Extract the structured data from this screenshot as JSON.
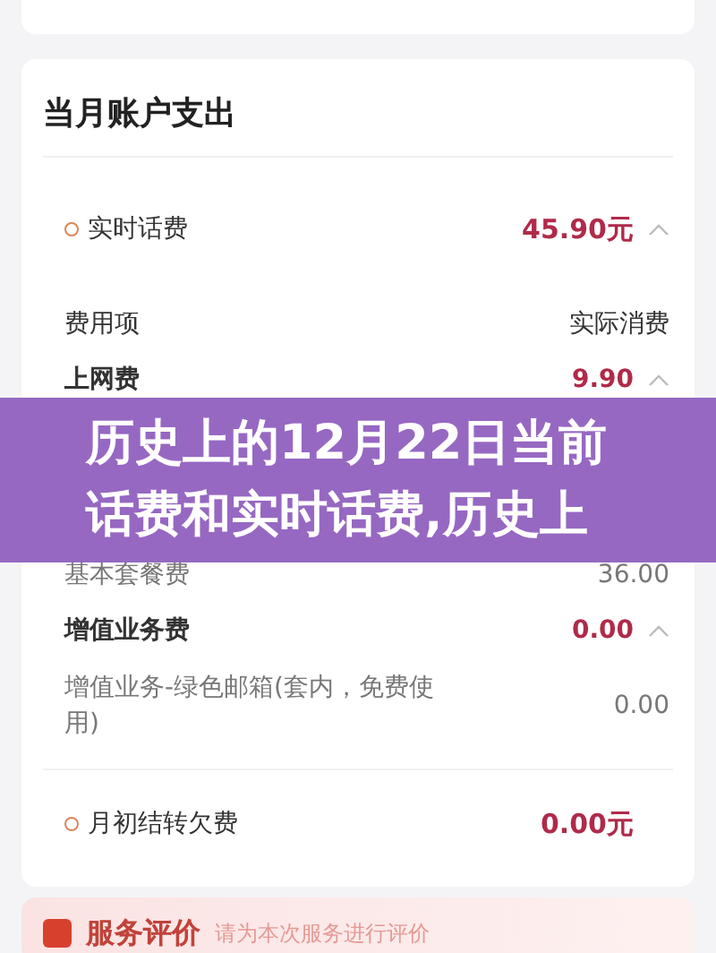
{
  "card_title": "当月账户支出",
  "rows": [
    {
      "kind": "section",
      "label": "实时话费",
      "amount": "45.90元",
      "expanded": true
    },
    {
      "kind": "header",
      "label": "费用项",
      "amount": "实际消费"
    },
    {
      "kind": "category",
      "label": "上网费",
      "amount": "9.90",
      "expanded": true
    },
    {
      "kind": "hidden"
    },
    {
      "kind": "item",
      "label": "基本套餐费",
      "amount": "36.00"
    },
    {
      "kind": "category",
      "label": "增值业务费",
      "amount": "0.00",
      "expanded": true
    },
    {
      "kind": "item",
      "label": "增值业务-绿色邮箱(套内，免费使用)",
      "amount": "0.00"
    },
    {
      "kind": "divider"
    },
    {
      "kind": "section",
      "label": "月初结转欠费",
      "amount": "0.00元"
    }
  ],
  "banner": {
    "title": "历史上的12月22日当前话费和实时话费,历史上"
  },
  "service": {
    "title": "服务评价",
    "hint": "请为本次服务进行评价"
  }
}
